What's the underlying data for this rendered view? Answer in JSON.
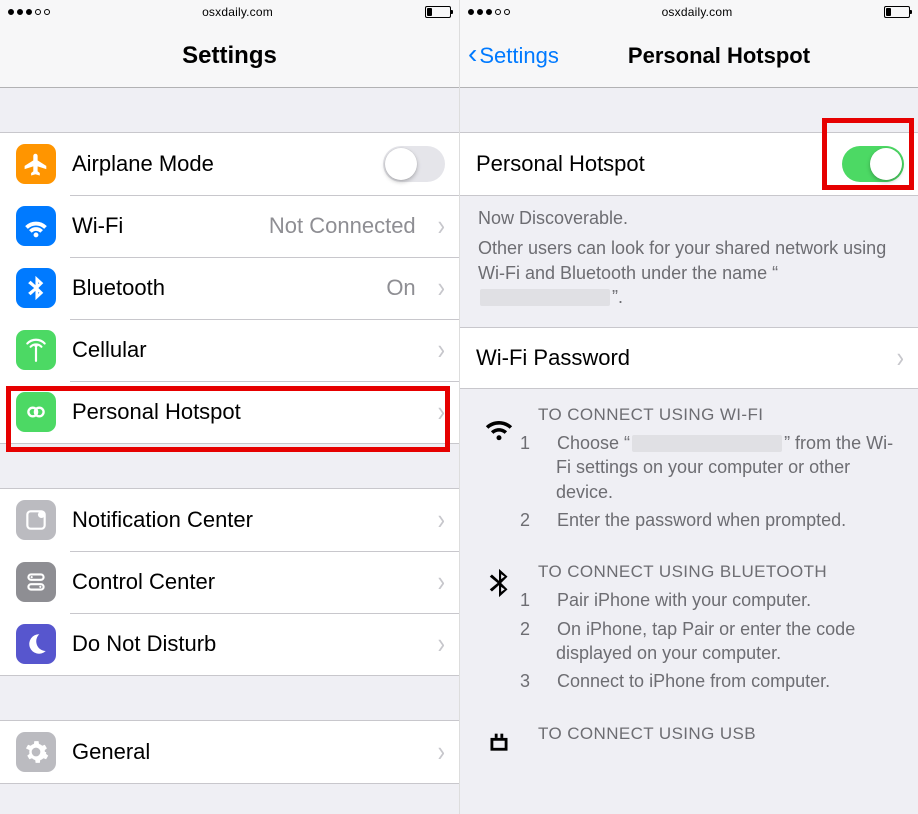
{
  "url": "osxdaily.com",
  "battery_level_pct": 20,
  "left": {
    "nav_title": "Settings",
    "rows": {
      "airplane": {
        "label": "Airplane Mode"
      },
      "wifi": {
        "label": "Wi-Fi",
        "value": "Not Connected"
      },
      "bluetooth": {
        "label": "Bluetooth",
        "value": "On"
      },
      "cellular": {
        "label": "Cellular"
      },
      "hotspot": {
        "label": "Personal Hotspot"
      },
      "notif": {
        "label": "Notification Center"
      },
      "control": {
        "label": "Control Center"
      },
      "dnd": {
        "label": "Do Not Disturb"
      },
      "general": {
        "label": "General"
      }
    }
  },
  "right": {
    "back_label": "Settings",
    "nav_title": "Personal Hotspot",
    "toggle_row_label": "Personal Hotspot",
    "toggle_on": true,
    "discover_line": "Now Discoverable.",
    "discover_desc_prefix": "Other users can look for your shared network using Wi-Fi and Bluetooth under the name “",
    "discover_desc_suffix": "”.",
    "wifi_password_label": "Wi-Fi Password",
    "instructions": {
      "wifi": {
        "title": "TO CONNECT USING WI-FI",
        "step1_prefix": "Choose “",
        "step1_suffix": "” from the Wi-Fi settings on your computer or other device.",
        "step2": "Enter the password when prompted."
      },
      "bt": {
        "title": "TO CONNECT USING BLUETOOTH",
        "step1": "Pair iPhone with your computer.",
        "step2": "On iPhone, tap Pair or enter the code displayed on your computer.",
        "step3": "Connect to iPhone from computer."
      },
      "usb": {
        "title": "TO CONNECT USING USB"
      }
    }
  }
}
